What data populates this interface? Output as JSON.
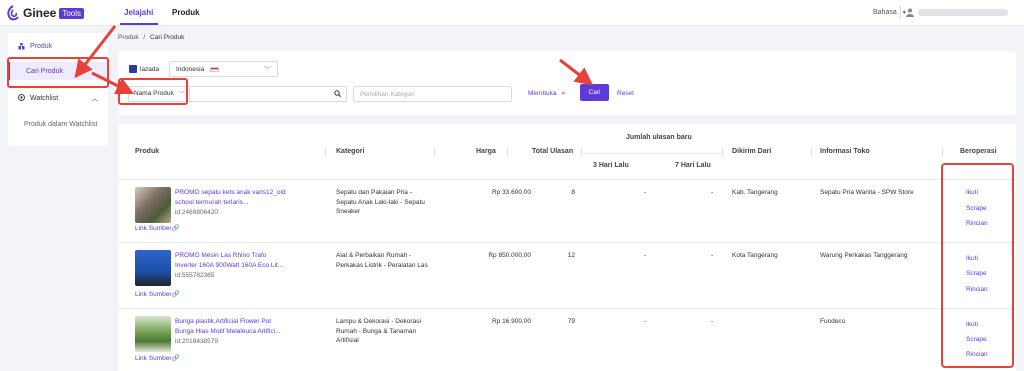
{
  "header": {
    "logo_text": "Ginee",
    "logo_badge": "Tools",
    "tabs": [
      {
        "label": "Jelajahi",
        "active": true
      },
      {
        "label": "Produk",
        "active": false
      }
    ],
    "language": "Bahasa"
  },
  "sidebar": {
    "items": [
      {
        "label": "Produk",
        "icon": "box-icon"
      },
      {
        "label": "Cari Produk",
        "active": true
      },
      {
        "label": "Watchlist",
        "icon": "eye-icon"
      },
      {
        "label": "Produk dalam Watchlist"
      }
    ]
  },
  "breadcrumb": {
    "root": "Produk",
    "separator": "/",
    "current": "Cari Produk"
  },
  "filters": {
    "marketplace_label": "lazada",
    "country": "Indonesia",
    "search_type": "Nama Produk",
    "search_placeholder": "",
    "category_placeholder": "Pemilihan Kategori",
    "expand_label": "Membuka",
    "search_button": "Cari",
    "reset_button": "Reset"
  },
  "table": {
    "headers": {
      "product": "Produk",
      "category": "Kategori",
      "price": "Harga",
      "total_reviews": "Total Ulasan",
      "new_reviews": "Jumlah ulasan baru",
      "days3": "3 Hari Lalu",
      "days7": "7 Hari Lalu",
      "ship_from": "Dikirim Dari",
      "store_info": "Informasi Toko",
      "actions": "Beroperasi"
    },
    "rows": [
      {
        "title1": "PROMO sepatu kets anak vans12_old",
        "title2": "school termurah terlaris...",
        "id": "id:2469806420",
        "source": "Link Sumber",
        "category1": "Sepatu dan Pakaian Pria -",
        "category2": "Sepatu Anak Laki-laki - Sepatu",
        "category3": "Sneaker",
        "price": "Rp 33.600,00",
        "total": "8",
        "d3": "-",
        "d7": "-",
        "ship": "Kab. Tangerang",
        "store": "Sepatu Pria Wanita - SPW Store"
      },
      {
        "title1": "PROMO Mesin Las Rhino Trafo",
        "title2": "Inverter 160A 900Watt 160A Eco Lit...",
        "id": "id:555782385",
        "source": "Link Sumber",
        "category1": "Alat & Perbaikan Rumah -",
        "category2": "Perkakas Listrik - Peralatan Las",
        "category3": "",
        "price": "Rp 850.000,00",
        "total": "12",
        "d3": "-",
        "d7": "-",
        "ship": "Kota Tangerang",
        "store": "Warung Perkakas Tanggerang"
      },
      {
        "title1": "Bunga plastik Artificial Flower Pot",
        "title2": "Bunga Hias Motif Melaleuca Artifici...",
        "id": "id:2018438579",
        "source": "Link Sumber",
        "category1": "Lampu & Dekorasi - Dekorasi",
        "category2": "Rumah - Bunga & Tanaman",
        "category3": "Artifisial",
        "price": "Rp 16.900,00",
        "total": "79",
        "d3": "-",
        "d7": "-",
        "ship": "",
        "store": "Fundeco"
      }
    ],
    "actions": {
      "follow": "Ikuti",
      "scrape": "Scrape",
      "detail": "Rincian"
    }
  },
  "colors": {
    "accent": "#5b3cd6",
    "annotation": "#e8413a",
    "lazada": "#2b3aa0"
  }
}
